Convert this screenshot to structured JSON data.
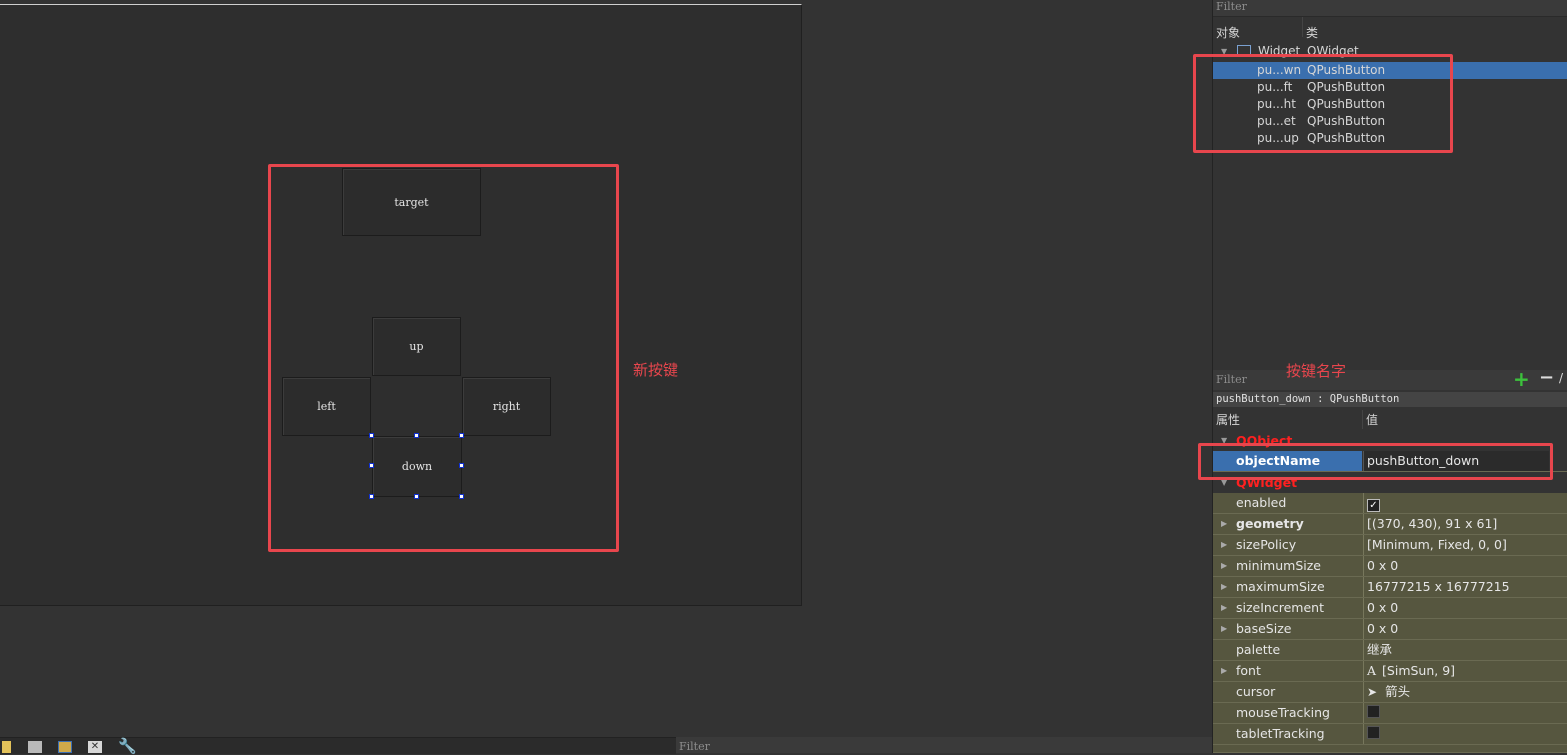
{
  "canvas": {
    "buttons": {
      "target": "target",
      "up": "up",
      "left": "left",
      "right": "right",
      "down": "down"
    },
    "annotation_new_buttons": "新按键"
  },
  "object_inspector": {
    "filter_label": "Filter",
    "header_object": "对象",
    "header_class": "类",
    "root": {
      "name": "Widget",
      "class": "QWidget"
    },
    "rows": [
      {
        "name": "pu...wn",
        "class": "QPushButton",
        "selected": true
      },
      {
        "name": "pu...ft",
        "class": "QPushButton",
        "selected": false
      },
      {
        "name": "pu...ht",
        "class": "QPushButton",
        "selected": false
      },
      {
        "name": "pu...et",
        "class": "QPushButton",
        "selected": false
      },
      {
        "name": "pu...up",
        "class": "QPushButton",
        "selected": false
      }
    ]
  },
  "property_editor": {
    "filter_label": "Filter",
    "annotation_button_name": "按键名字",
    "selection_title": "pushButton_down : QPushButton",
    "header_property": "属性",
    "header_value": "值",
    "category_qobject": "QObject",
    "category_qwidget": "QWidget",
    "object_name": {
      "name": "objectName",
      "value": "pushButton_down"
    },
    "properties": [
      {
        "name": "enabled",
        "value": "",
        "checkbox": true,
        "checked": true,
        "expandable": false
      },
      {
        "name": "geometry",
        "value": "[(370, 430), 91 x 61]",
        "bold": true,
        "expandable": true
      },
      {
        "name": "sizePolicy",
        "value": "[Minimum, Fixed, 0, 0]",
        "expandable": true
      },
      {
        "name": "minimumSize",
        "value": "0 x 0",
        "expandable": true
      },
      {
        "name": "maximumSize",
        "value": "16777215 x 16777215",
        "expandable": true
      },
      {
        "name": "sizeIncrement",
        "value": "0 x 0",
        "expandable": true
      },
      {
        "name": "baseSize",
        "value": "0 x 0",
        "expandable": true
      },
      {
        "name": "palette",
        "value": "继承",
        "expandable": false
      },
      {
        "name": "font",
        "value": "[SimSun, 9]",
        "icon": "A",
        "expandable": true
      },
      {
        "name": "cursor",
        "value": "箭头",
        "icon": "cursor-icon",
        "expandable": false
      },
      {
        "name": "mouseTracking",
        "value": "",
        "checkbox": true,
        "checked": false,
        "expandable": false
      },
      {
        "name": "tabletTracking",
        "value": "",
        "checkbox": true,
        "checked": false,
        "expandable": false
      }
    ]
  },
  "bottom_bar": {
    "filter_label": "Filter"
  },
  "colors": {
    "annotation": "#e8464d",
    "selection": "#3a6fae",
    "property_bg": "#56563f",
    "category": "#ff2020"
  }
}
